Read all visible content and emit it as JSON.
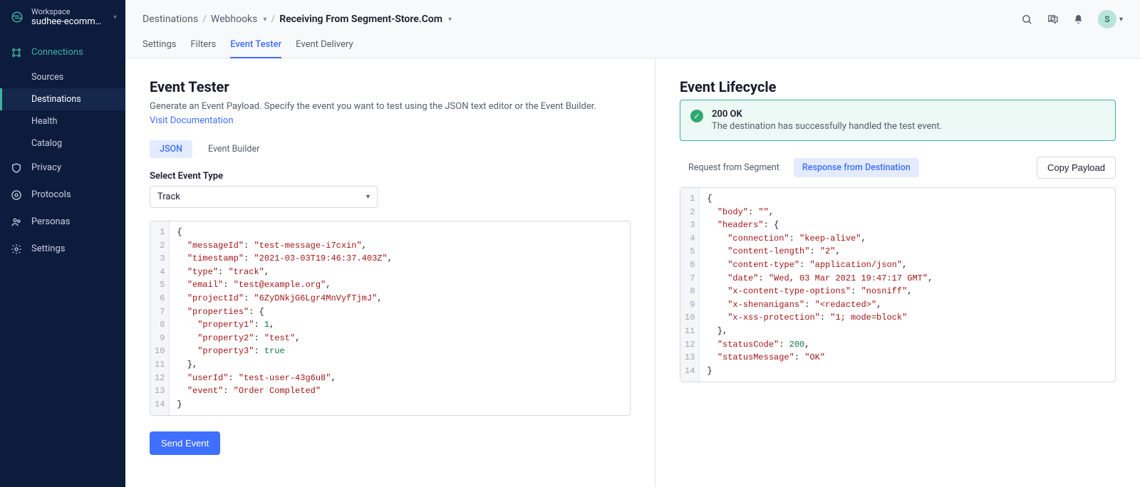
{
  "workspace": {
    "label": "Workspace",
    "name": "sudhee-ecommer..."
  },
  "nav": {
    "connections": "Connections",
    "subs": [
      "Sources",
      "Destinations",
      "Health",
      "Catalog"
    ],
    "items": [
      "Privacy",
      "Protocols",
      "Personas",
      "Settings"
    ]
  },
  "breadcrumbs": {
    "a": "Destinations",
    "b": "Webhooks",
    "c": "Receiving From Segment-Store.Com"
  },
  "topbar": {
    "avatar_letter": "S"
  },
  "tabs": [
    "Settings",
    "Filters",
    "Event Tester",
    "Event Delivery"
  ],
  "left": {
    "title": "Event Tester",
    "desc_prefix": "Generate an Event Payload. Specify the event you want to test using the JSON text editor or the Event Builder. ",
    "desc_link": "Visit Documentation",
    "pill_json": "JSON",
    "pill_builder": "Event Builder",
    "select_label": "Select Event Type",
    "select_value": "Track",
    "send_button": "Send Event",
    "payload": {
      "messageId": "test-message-i7cxin",
      "timestamp": "2021-03-03T19:46:37.403Z",
      "type": "track",
      "email": "test@example.org",
      "projectId": "6ZyDNkjG6Lgr4MnVyfTjmJ",
      "properties": {
        "property1": 1,
        "property2": "test",
        "property3": true
      },
      "userId": "test-user-43g6u8",
      "event": "Order Completed"
    }
  },
  "right": {
    "title": "Event Lifecycle",
    "status_title": "200 OK",
    "status_msg": "The destination has successfully handled the test event.",
    "tab_req": "Request from Segment",
    "tab_resp": "Response from Destination",
    "copy_button": "Copy Payload",
    "response": {
      "body": "",
      "headers": {
        "connection": "keep-alive",
        "content-length": "2",
        "content-type": "application/json",
        "date": "Wed, 03 Mar 2021 19:47:17 GMT",
        "x-content-type-options": "nosniff",
        "x-shenanigans": "<redacted>",
        "x-xss-protection": "1; mode=block"
      },
      "statusCode": 200,
      "statusMessage": "OK"
    }
  }
}
